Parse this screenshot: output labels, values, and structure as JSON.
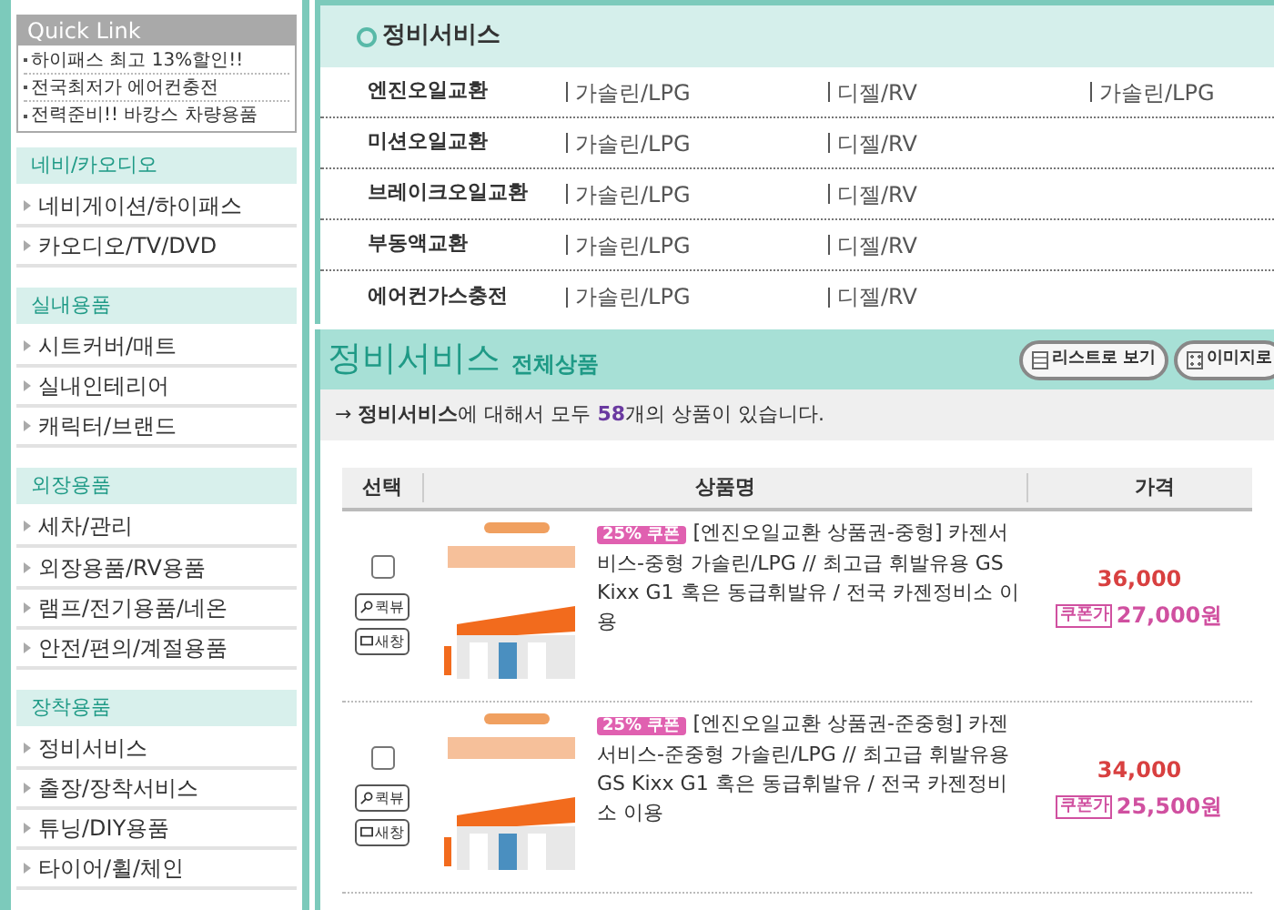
{
  "sidebar": {
    "quick_link": {
      "title": "Quick Link",
      "items": [
        "하이패스 최고 13%할인!!",
        "전국최저가 에어컨충전",
        "전력준비!! 바캉스 차량용품"
      ]
    },
    "sections": [
      {
        "title": "네비/카오디오",
        "items": [
          "네비게이션/하이패스",
          "카오디오/TV/DVD"
        ]
      },
      {
        "title": "실내용품",
        "items": [
          "시트커버/매트",
          "실내인테리어",
          "캐릭터/브랜드"
        ]
      },
      {
        "title": "외장용품",
        "items": [
          "세차/관리",
          "외장용품/RV용품",
          "램프/전기용품/네온",
          "안전/편의/계절용품"
        ]
      },
      {
        "title": "장착용품",
        "items": [
          "정비서비스",
          "출장/장착서비스",
          "튜닝/DIY용품",
          "타이어/휠/체인"
        ]
      }
    ]
  },
  "service_box": {
    "title": "정비서비스",
    "rows": [
      {
        "name": "엔진오일교환",
        "options": [
          "가솔린/LPG",
          "디젤/RV",
          "가솔린/LPG"
        ]
      },
      {
        "name": "미션오일교환",
        "options": [
          "가솔린/LPG",
          "디젤/RV"
        ]
      },
      {
        "name": "브레이크오일교환",
        "options": [
          "가솔린/LPG",
          "디젤/RV"
        ]
      },
      {
        "name": "부동액교환",
        "options": [
          "가솔린/LPG",
          "디젤/RV"
        ]
      },
      {
        "name": "에어컨가스충전",
        "options": [
          "가솔린/LPG",
          "디젤/RV"
        ]
      }
    ]
  },
  "listing": {
    "title": "정비서비스",
    "subtitle": "전체상품",
    "view_buttons": [
      {
        "label": "리스트로 보기",
        "kind": "list"
      },
      {
        "label": "이미지로"
      }
    ],
    "summary": "→ **정비서비스**에 대해서 모두 **58**개의 상품이 있습니다.",
    "columns": [
      "선택",
      "상품명",
      "가격"
    ],
    "products": [
      {
        "checked": false,
        "quick_view": "퀵뷰",
        "new_window": "새창",
        "coupon": "25% 쿠폰",
        "name": "[엔진오일교환 상품권-중형] 카젠서비스-중형 가솔린/LPG // 최고급 휘발유용 GS Kixx G1 혹은 동급휘발유 / 전국 카젠정비소 이용",
        "price": "36,000",
        "coupon_label": "쿠폰가",
        "coupon_price": "27,000원"
      },
      {
        "checked": false,
        "quick_view": "퀵뷰",
        "new_window": "새창",
        "coupon": "25% 쿠폰",
        "name": "[엔진오일교환 상품권-준중형] 카젠 서비스-준중형 가솔린/LPG // 최고급 휘발유용 GS Kixx G1 혹은 동급휘발유 / 전국 카젠정비소 이용",
        "price": "34,000",
        "coupon_label": "쿠폰가",
        "coupon_price": "25,500원"
      }
    ]
  }
}
